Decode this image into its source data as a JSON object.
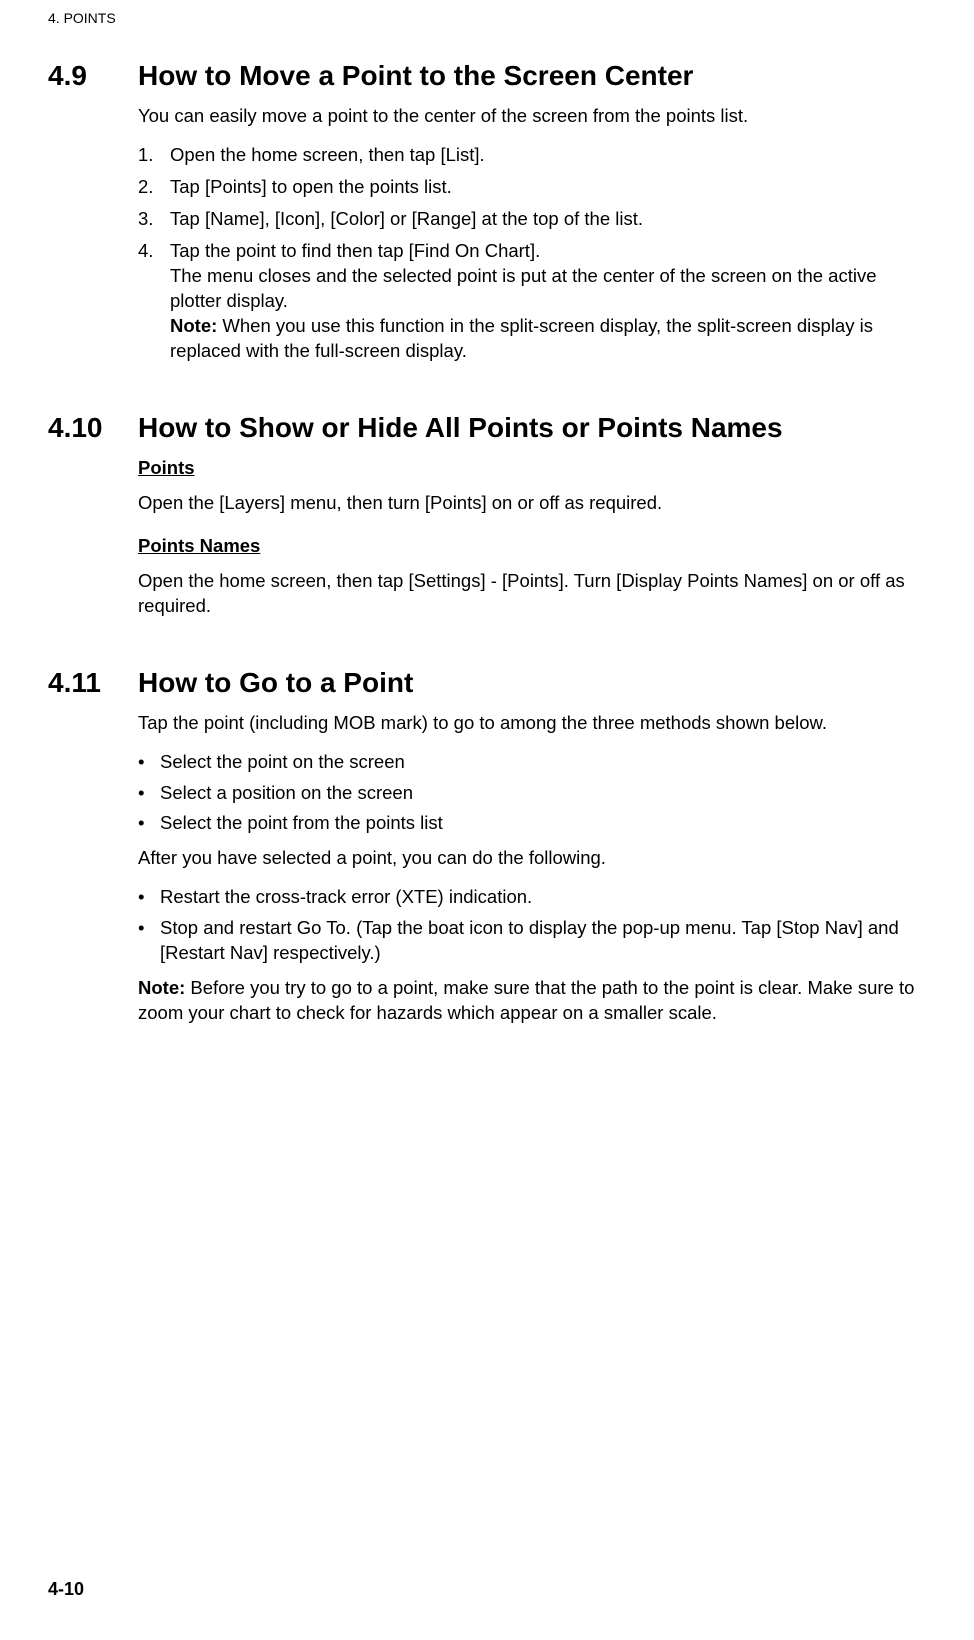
{
  "header": {
    "chapter": "4.  POINTS",
    "pageNumber": "4-10"
  },
  "sections": [
    {
      "num": "4.9",
      "title": "How to Move a Point to the Screen Center",
      "intro": "You can easily move a point to the center of the screen from the points list.",
      "steps": [
        {
          "n": "1.",
          "text": "Open the home screen, then tap [List]."
        },
        {
          "n": "2.",
          "text": "Tap [Points] to open the points list."
        },
        {
          "n": "3.",
          "text": "Tap [Name], [Icon], [Color] or [Range] at the top of the list."
        },
        {
          "n": "4.",
          "text_a": "Tap the point to find then tap [Find On Chart].",
          "text_b": "The menu closes and the selected point is put at the center of the screen on the active plotter display.",
          "note_label": "Note:",
          "note_text": " When you use this function in the split-screen display, the split-screen display is replaced with the full-screen display."
        }
      ]
    },
    {
      "num": "4.10",
      "title": "How to Show or Hide All Points or Points Names",
      "subs": [
        {
          "head": "Points",
          "body": "Open the [Layers] menu, then turn [Points] on or off as required."
        },
        {
          "head": "Points Names",
          "body": "Open the home screen, then tap [Settings] - [Points]. Turn [Display Points Names] on or off as required."
        }
      ]
    },
    {
      "num": "4.11",
      "title": "How to Go to a Point",
      "intro": "Tap the point (including MOB mark) to go to among the three methods shown below.",
      "bullets1": [
        "Select the point on the screen",
        "Select a position on the screen",
        "Select the point from the points list"
      ],
      "after1": "After you have selected a point, you can do the following.",
      "bullets2": [
        "Restart the cross-track error (XTE) indication.",
        "Stop and restart Go To. (Tap the boat icon to display the pop-up menu. Tap [Stop Nav] and [Restart Nav] respectively.)"
      ],
      "note_label": "Note:",
      "note_text": " Before you try to go to a point, make sure that the path to the point is clear. Make sure to zoom your chart to check for hazards which appear on a smaller scale."
    }
  ]
}
